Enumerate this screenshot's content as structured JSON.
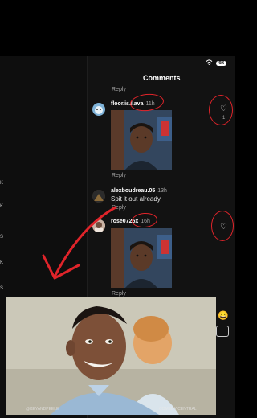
{
  "status": {
    "battery": "93"
  },
  "comments_panel": {
    "title": "Comments",
    "reply_label": "Reply",
    "items": [
      {
        "username": "floor.is.l.ava",
        "time": "11h",
        "likes": "1"
      },
      {
        "username": "alexboudreau.05",
        "time": "13h",
        "text": "Spit it out already"
      },
      {
        "username": "rose0725x",
        "time": "16h"
      }
    ]
  },
  "sidebar_labels": [
    "K",
    "K",
    "S",
    "K",
    "S"
  ],
  "video_overlay": {
    "watermark_left": "@KEYANDPEELE",
    "watermark_right": "COMEDY CENTRAL"
  },
  "colors": {
    "annotation": "#e0242a",
    "panel_bg": "#121212"
  }
}
